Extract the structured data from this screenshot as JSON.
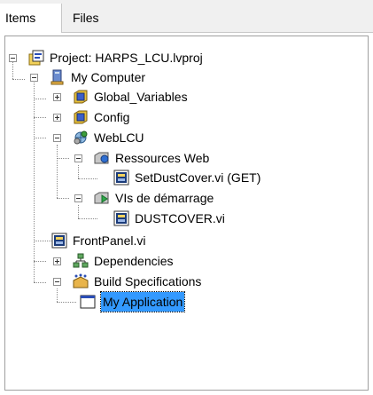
{
  "tabs": [
    {
      "label": "Items",
      "active": true
    },
    {
      "label": "Files",
      "active": false
    }
  ],
  "tree": {
    "nodes": [
      {
        "label": "Project: HARPS_LCU.lvproj",
        "icon": "project-icon",
        "expander": "collapse"
      },
      {
        "label": "My Computer",
        "icon": "computer-icon",
        "expander": "collapse"
      },
      {
        "label": "Global_Variables",
        "icon": "folder-icon",
        "expander": "expand"
      },
      {
        "label": "Config",
        "icon": "folder-icon",
        "expander": "expand"
      },
      {
        "label": "WebLCU",
        "icon": "web-service-icon",
        "expander": "collapse"
      },
      {
        "label": "Ressources Web",
        "icon": "web-resources-folder-icon",
        "expander": "collapse"
      },
      {
        "label": "SetDustCover.vi (GET)",
        "icon": "vi-icon",
        "expander": "none"
      },
      {
        "label": "VIs de démarrage",
        "icon": "startup-vis-folder-icon",
        "expander": "collapse"
      },
      {
        "label": "DUSTCOVER.vi",
        "icon": "vi-icon",
        "expander": "none"
      },
      {
        "label": "FrontPanel.vi",
        "icon": "vi-icon",
        "expander": "none"
      },
      {
        "label": "Dependencies",
        "icon": "dependencies-icon",
        "expander": "expand"
      },
      {
        "label": "Build Specifications",
        "icon": "build-specifications-icon",
        "expander": "collapse"
      },
      {
        "label": "My Application",
        "icon": "application-icon",
        "expander": "none",
        "selected": true
      }
    ]
  },
  "colors": {
    "selection": "#3399ff",
    "tab_background": "#f0f0f0",
    "folder_yellow": "#e8c23a",
    "folder_blue": "#3b5ec9"
  }
}
